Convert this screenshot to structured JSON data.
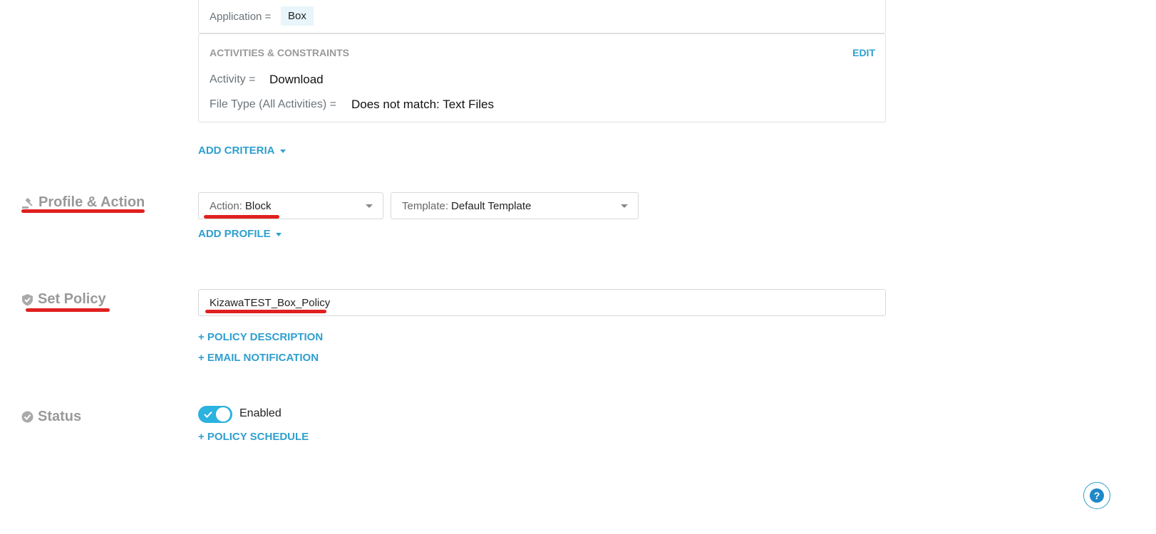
{
  "criteria": {
    "application_label": "Application =",
    "application_value": "Box",
    "activities_heading": "ACTIVITIES & CONSTRAINTS",
    "edit_label": "EDIT",
    "activity_label": "Activity =",
    "activity_value": "Download",
    "filetype_label": "File Type (All Activities) =",
    "filetype_value": "Does not match: Text Files",
    "add_criteria_label": "ADD CRITERIA"
  },
  "profile_action": {
    "title": "Profile & Action",
    "action_key": "Action:",
    "action_value": "Block",
    "template_key": "Template:",
    "template_value": "Default Template",
    "add_profile_label": "ADD PROFILE"
  },
  "set_policy": {
    "title": "Set Policy",
    "policy_name": "KizawaTEST_Box_Policy",
    "policy_description_label": "+ POLICY DESCRIPTION",
    "email_notification_label": "+ EMAIL NOTIFICATION"
  },
  "status": {
    "title": "Status",
    "toggle_on": true,
    "toggle_label": "Enabled",
    "policy_schedule_label": "+ POLICY SCHEDULE"
  },
  "colors": {
    "accent": "#2f9fcf",
    "toggle": "#2bb2de",
    "annotation": "#e02020"
  },
  "icons": {
    "profile": "gavel-icon",
    "policy": "shield-check-icon",
    "status": "check-circle-icon",
    "help": "help-icon"
  }
}
